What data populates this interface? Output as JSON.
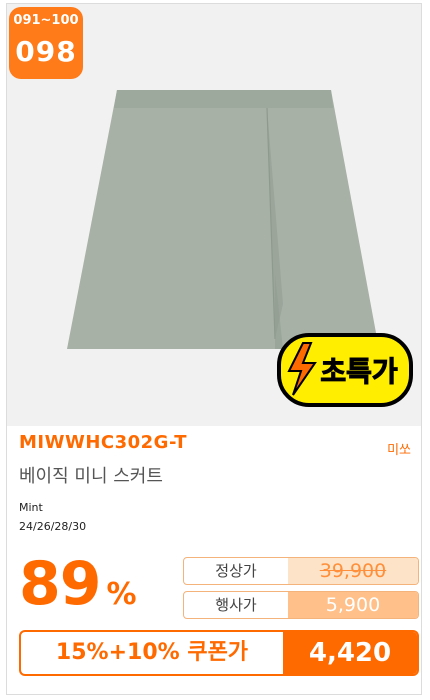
{
  "rank": {
    "range": "091~100",
    "number": "098"
  },
  "promo_badge": {
    "text": "초특가"
  },
  "product": {
    "model_code": "MIWWHC302G-T",
    "brand": "미쏘",
    "name": "베이직 미니 스커트",
    "color": "Mint",
    "sizes": "24/26/28/30"
  },
  "pricing": {
    "discount_number": "89",
    "discount_symbol": "%",
    "regular_label": "정상가",
    "regular_price": "39,900",
    "event_label": "행사가",
    "event_price": "5,900",
    "coupon_label": "15%+10% 쿠폰가",
    "coupon_price": "4,420"
  },
  "colors": {
    "accent": "#ff6a00",
    "skirt": "#a7b1a6"
  }
}
